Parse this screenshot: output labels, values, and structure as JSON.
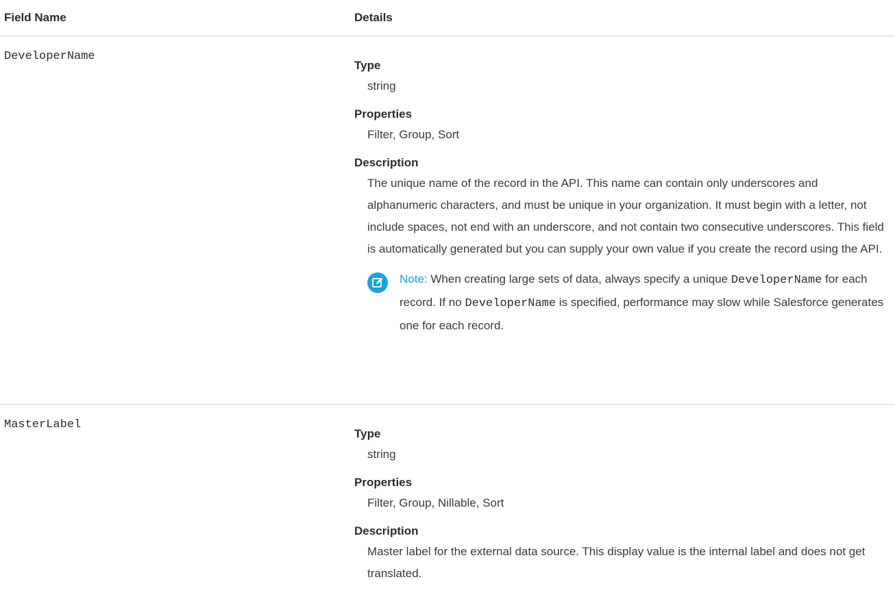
{
  "header": {
    "col_field_name": "Field Name",
    "col_details": "Details"
  },
  "rows": [
    {
      "field_name": "DeveloperName",
      "type_label": "Type",
      "type_value": "string",
      "properties_label": "Properties",
      "properties_value": "Filter, Group, Sort",
      "description_label": "Description",
      "description_value": "The unique name of the record in the API. This name can contain only underscores and alphanumeric characters, and must be unique in your organization. It must begin with a letter, not include spaces, not end with an underscore, and not contain two consecutive underscores. This field is automatically generated but you can supply your own value if you create the record using the API.",
      "note": {
        "icon": "note-pencil-icon",
        "label": "Note:",
        "text_1": " When creating large sets of data, always specify a unique ",
        "code_1": "DeveloperName",
        "text_2": " for each record. If no ",
        "code_2": "DeveloperName",
        "text_3": " is specified, performance may slow while Salesforce generates one for each record."
      }
    },
    {
      "field_name": "MasterLabel",
      "type_label": "Type",
      "type_value": "string",
      "properties_label": "Properties",
      "properties_value": "Filter, Group, Nillable, Sort",
      "description_label": "Description",
      "description_value": "Master label for the external data source. This display value is the internal label and does not get translated."
    }
  ],
  "colors": {
    "note_accent": "#1aa3d8",
    "divider": "#d4d4d4"
  }
}
